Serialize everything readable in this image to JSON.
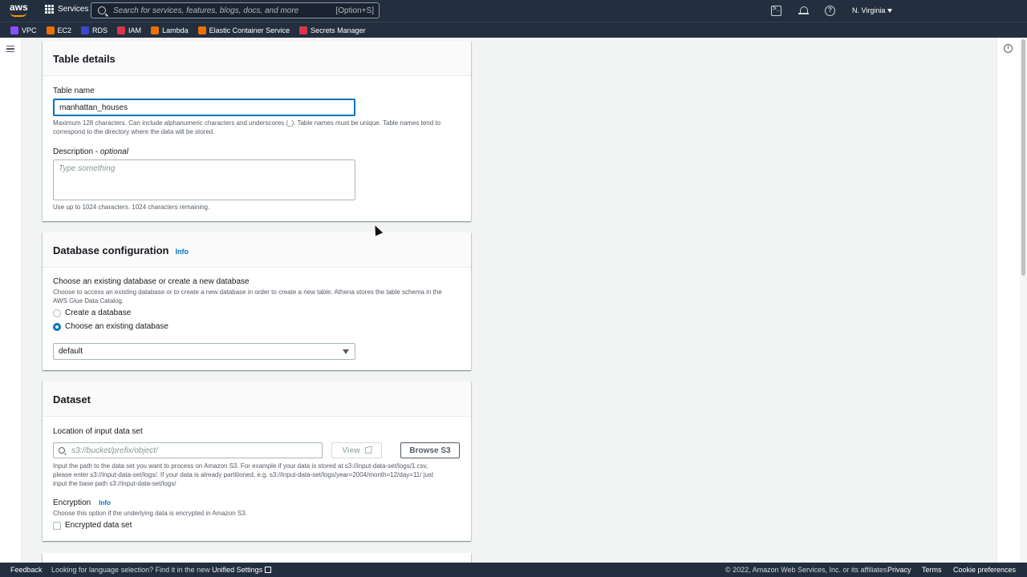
{
  "topnav": {
    "logo": "aws",
    "services_label": "Services",
    "search_placeholder": "Search for services, features, blogs, docs, and more",
    "search_shortcut": "[Option+S]",
    "region": "N. Virginia"
  },
  "favorites": [
    {
      "label": "VPC",
      "color": "#8c4fff"
    },
    {
      "label": "EC2",
      "color": "#ed7100"
    },
    {
      "label": "RDS",
      "color": "#3b48cc"
    },
    {
      "label": "IAM",
      "color": "#dd344c"
    },
    {
      "label": "Lambda",
      "color": "#ed7100"
    },
    {
      "label": "Elastic Container Service",
      "color": "#ed7100"
    },
    {
      "label": "Secrets Manager",
      "color": "#dd344c"
    }
  ],
  "table_details": {
    "title": "Table details",
    "name_label": "Table name",
    "name_value": "manhattan_houses",
    "name_hint_1": "Maximum 128 characters. Can include alphanumeric characters and underscores (_). Table names must be unique. Table names tend to",
    "name_hint_2": "correspond to the directory where the data will be stored.",
    "desc_label": "Description - ",
    "desc_optional": "optional",
    "desc_placeholder": "Type something",
    "desc_hint": "Use up to 1024 characters. 1024 characters remaining."
  },
  "database_config": {
    "title": "Database configuration",
    "info": "Info",
    "choose_label": "Choose an existing database or create a new database",
    "choose_hint_1": "Choose to access an existing database or to create a new database in order to create a new table. Athena stores the table schema in the",
    "choose_hint_2": "AWS Glue Data Catalog.",
    "option_create": "Create a database",
    "option_existing": "Choose an existing database",
    "selected_db": "default"
  },
  "dataset": {
    "title": "Dataset",
    "location_label": "Location of input data set",
    "location_placeholder": "s3://bucket/prefix/object/",
    "view_button": "View",
    "browse_button": "Browse S3",
    "location_hint_1": "Input the path to the data set you want to process on Amazon S3. For example if your data is stored at s3://input-data-set/logs/1.csv,",
    "location_hint_2": "please enter s3://input-data-set/logs/. If your data is already partitioned, e.g. s3://input-data-set/logs/year=2004/month=12/day=11/ just",
    "location_hint_3": "input the base path s3://input-data-set/logs/",
    "encryption_label": "Encryption",
    "encryption_info": "Info",
    "encryption_hint": "Choose this option if the underlying data is encrypted in Amazon S3.",
    "encrypted_checkbox": "Encrypted data set"
  },
  "footer": {
    "feedback": "Feedback",
    "language_text": "Looking for language selection? Find it in the new",
    "unified_settings": "Unified Settings",
    "copyright": "© 2022, Amazon Web Services, Inc. or its affiliates.",
    "privacy": "Privacy",
    "terms": "Terms",
    "cookies": "Cookie preferences"
  }
}
